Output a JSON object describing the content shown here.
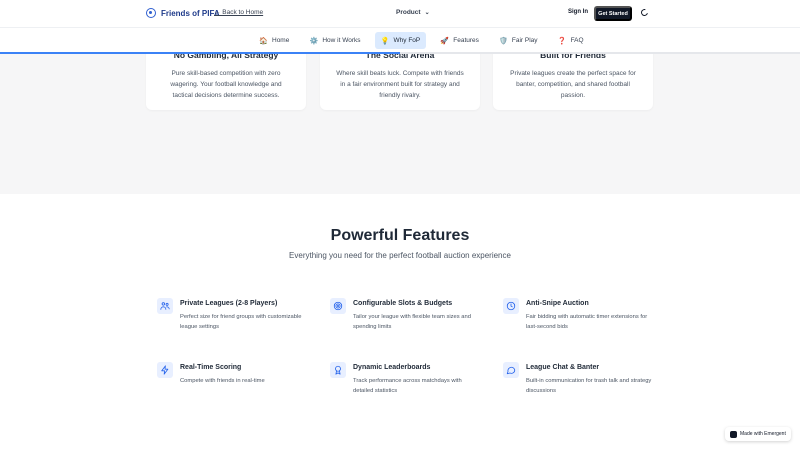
{
  "header": {
    "brand": "Friends of PIFA",
    "back_link": "← Back to Home",
    "product_menu": "Product",
    "sign_in": "Sign In",
    "get_started": "Get Started"
  },
  "section_nav": {
    "progress": 0.5,
    "items": [
      {
        "label": "Home",
        "icon": "house-icon",
        "glyph": "🏠",
        "active": false
      },
      {
        "label": "How it Works",
        "icon": "gear-icon",
        "glyph": "⚙️",
        "active": false
      },
      {
        "label": "Why FoP",
        "icon": "lightbulb-icon",
        "glyph": "💡",
        "active": true
      },
      {
        "label": "Features",
        "icon": "rocket-icon",
        "glyph": "🚀",
        "active": false
      },
      {
        "label": "Fair Play",
        "icon": "shield-icon",
        "glyph": "🛡️",
        "active": false
      },
      {
        "label": "FAQ",
        "icon": "question-icon",
        "glyph": "❓",
        "active": false
      }
    ]
  },
  "why_cards": [
    {
      "title": "No Gambling, All Strategy",
      "description": "Pure skill-based competition with zero wagering. Your football knowledge and tactical decisions determine success.",
      "accent": "#b7e4c2"
    },
    {
      "title": "The Social Arena",
      "description": "Where skill beats luck. Compete with friends in a fair environment built for strategy and friendly rivalry.",
      "accent": "#c7d6fb"
    },
    {
      "title": "Built for Friends",
      "description": "Private leagues create the perfect space for banter, competition, and shared football passion.",
      "accent": "#f7c2c2"
    }
  ],
  "features": {
    "title": "Powerful Features",
    "subtitle": "Everything you need for the perfect football auction experience",
    "items": [
      {
        "title": "Private Leagues (2-8 Players)",
        "description": "Perfect size for friend groups with customizable league settings",
        "icon": "users-icon"
      },
      {
        "title": "Configurable Slots & Budgets",
        "description": "Tailor your league with flexible team sizes and spending limits",
        "icon": "target-icon"
      },
      {
        "title": "Anti-Snipe Auction",
        "description": "Fair bidding with automatic timer extensions for last-second bids",
        "icon": "clock-icon"
      },
      {
        "title": "Real-Time Scoring",
        "description": "Compete with friends in real-time",
        "icon": "lightning-icon"
      },
      {
        "title": "Dynamic Leaderboards",
        "description": "Track performance across matchdays with detailed statistics",
        "icon": "award-icon"
      },
      {
        "title": "League Chat & Banter",
        "description": "Built-in communication for trash talk and strategy discussions",
        "icon": "chat-icon"
      }
    ]
  },
  "badge": {
    "label": "Made with Emergent"
  },
  "colors": {
    "accent": "#3b82f6",
    "brand": "#1e3a8a",
    "active_tab": "#dbeafe",
    "icon_bg": "#e8efff",
    "dark_button": "#111827"
  }
}
